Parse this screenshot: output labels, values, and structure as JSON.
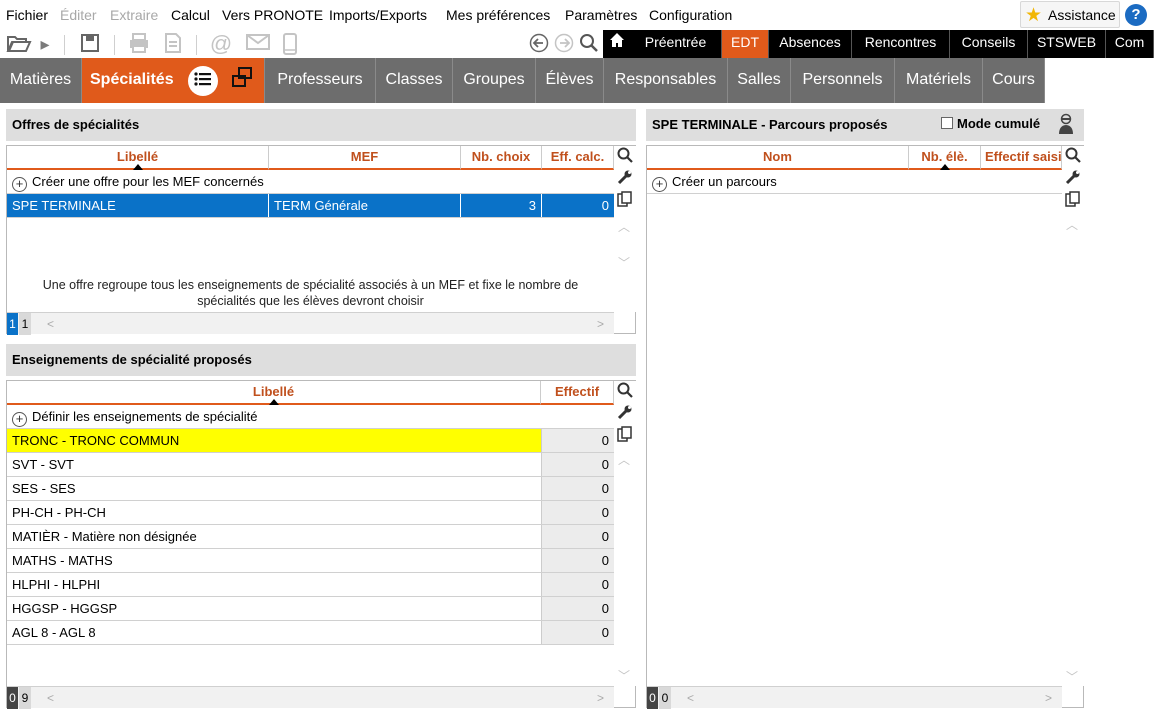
{
  "menu": {
    "items": [
      "Fichier",
      "Éditer",
      "Extraire",
      "Calcul",
      "Vers PRONOTE",
      "Imports/Exports",
      "Mes préférences",
      "Paramètres",
      "Configuration"
    ],
    "disabled": [
      false,
      true,
      true,
      false,
      false,
      false,
      false,
      false,
      false
    ],
    "assistance": "Assistance",
    "help": "?"
  },
  "toolbar": {
    "icons": [
      "folder-open-icon",
      "play-icon",
      "save-icon",
      "print-icon",
      "document-icon",
      "at-icon",
      "mail-icon",
      "mobile-icon"
    ],
    "nav_icons": [
      "back-icon",
      "forward-icon",
      "search-icon"
    ]
  },
  "top_tabs": [
    {
      "label": "Préentrée",
      "active": false
    },
    {
      "label": "EDT",
      "active": true
    },
    {
      "label": "Absences",
      "active": false
    },
    {
      "label": "Rencontres",
      "active": false
    },
    {
      "label": "Conseils",
      "active": false
    },
    {
      "label": "STSWEB",
      "active": false
    },
    {
      "label": "Com",
      "active": false
    }
  ],
  "sub_tabs": [
    {
      "label": "Matières",
      "active": false
    },
    {
      "label": "Spécialités",
      "active": true
    },
    {
      "label": "Professeurs",
      "active": false
    },
    {
      "label": "Classes",
      "active": false
    },
    {
      "label": "Groupes",
      "active": false
    },
    {
      "label": "Élèves",
      "active": false
    },
    {
      "label": "Responsables",
      "active": false
    },
    {
      "label": "Salles",
      "active": false
    },
    {
      "label": "Personnels",
      "active": false
    },
    {
      "label": "Matériels",
      "active": false
    },
    {
      "label": "Cours",
      "active": false
    }
  ],
  "offres": {
    "title": "Offres de spécialités",
    "headers": [
      "Libellé",
      "MEF",
      "Nb. choix",
      "Eff. calc."
    ],
    "add_label": "Créer une offre pour les MEF concernés",
    "rows": [
      {
        "libelle": "SPE TERMINALE",
        "mef": "TERM Générale",
        "nb_choix": "3",
        "eff": "0"
      }
    ],
    "note": "Une offre regroupe tous les enseignements de spécialité associés à un MEF et fixe le nombre de spécialités que les élèves devront choisir",
    "footer_a": "1",
    "footer_b": "1"
  },
  "enseignements": {
    "title": "Enseignements de spécialité proposés",
    "headers": [
      "Libellé",
      "Effectif"
    ],
    "add_label": "Définir les enseignements de spécialité",
    "rows": [
      {
        "libelle": "TRONC - TRONC COMMUN",
        "effectif": "0",
        "highlight": true
      },
      {
        "libelle": "SVT - SVT",
        "effectif": "0"
      },
      {
        "libelle": "SES - SES",
        "effectif": "0"
      },
      {
        "libelle": "PH-CH - PH-CH",
        "effectif": "0"
      },
      {
        "libelle": "MATIÈR - Matière non désignée",
        "effectif": "0"
      },
      {
        "libelle": "MATHS - MATHS",
        "effectif": "0"
      },
      {
        "libelle": "HLPHI - HLPHI",
        "effectif": "0"
      },
      {
        "libelle": "HGGSP - HGGSP",
        "effectif": "0"
      },
      {
        "libelle": "AGL 8 - AGL 8",
        "effectif": "0"
      }
    ],
    "footer_a": "0",
    "footer_b": "9"
  },
  "parcours": {
    "title": "SPE TERMINALE - Parcours proposés",
    "mode_cumule": "Mode cumulé",
    "headers": [
      "Nom",
      "Nb. élè.",
      "Effectif saisi"
    ],
    "add_label": "Créer un parcours",
    "footer_a": "0",
    "footer_b": "0"
  },
  "colors": {
    "accent": "#e05a1b",
    "selection": "#0a72c8",
    "highlight": "#ffff00",
    "tab_bg": "#6d6d6d"
  }
}
